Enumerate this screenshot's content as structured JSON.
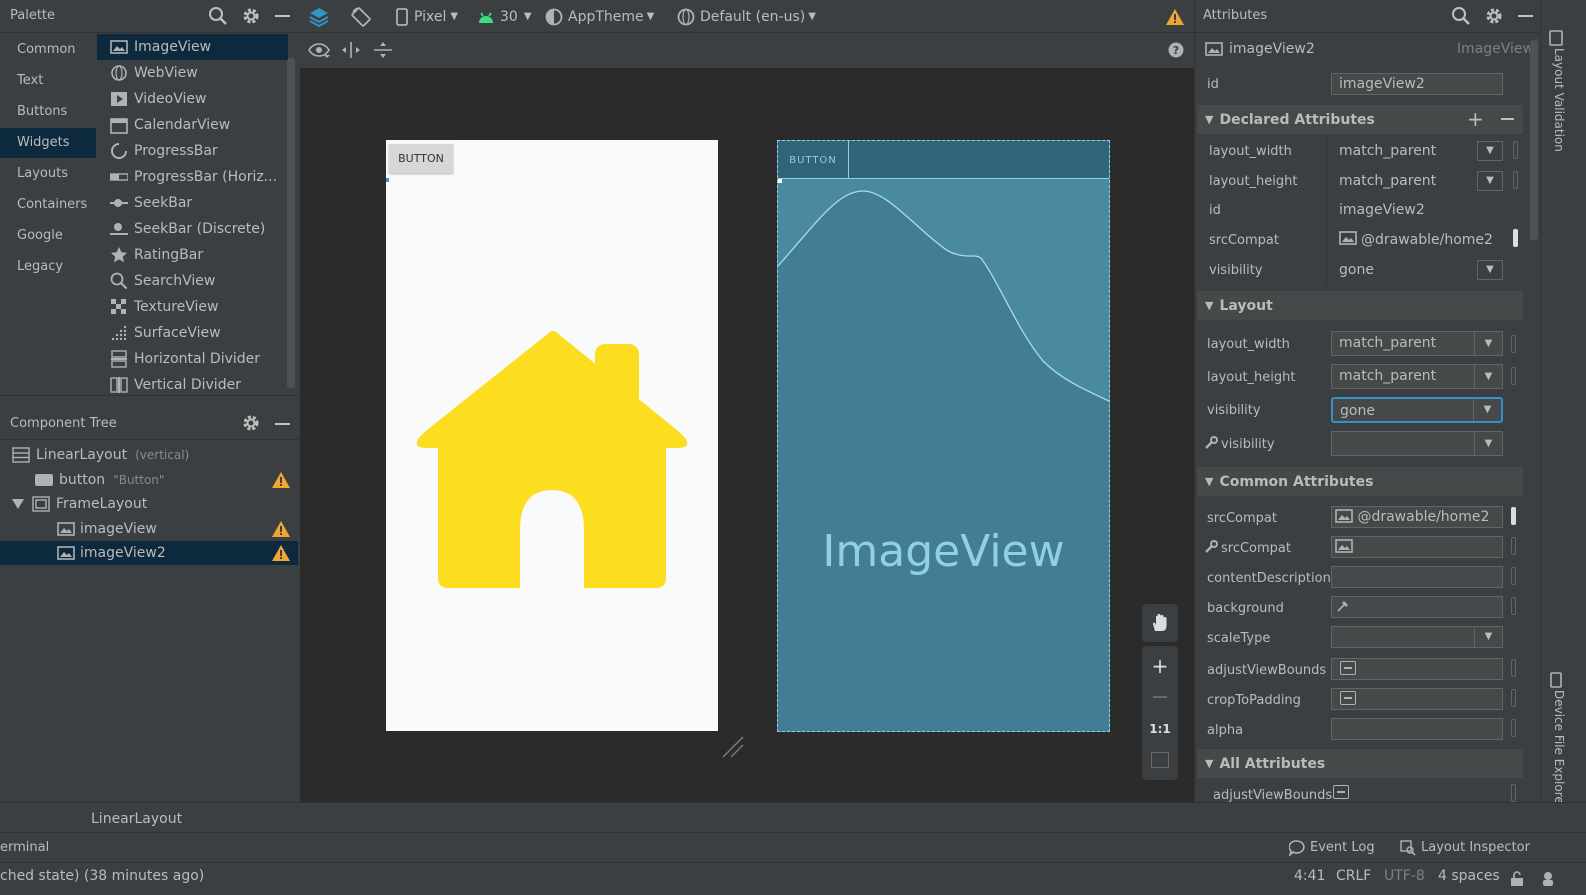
{
  "palette": {
    "title": "Palette",
    "categories": [
      "Common",
      "Text",
      "Buttons",
      "Widgets",
      "Layouts",
      "Containers",
      "Google",
      "Legacy"
    ],
    "selected_category": "Widgets",
    "items": [
      "ImageView",
      "WebView",
      "VideoView",
      "CalendarView",
      "ProgressBar",
      "ProgressBar (Horiz...",
      "SeekBar",
      "SeekBar (Discrete)",
      "RatingBar",
      "SearchView",
      "TextureView",
      "SurfaceView",
      "Horizontal Divider",
      "Vertical Divider"
    ],
    "selected_item": "ImageView"
  },
  "component_tree": {
    "title": "Component Tree",
    "nodes": [
      {
        "label": "LinearLayout",
        "hint": "(vertical)",
        "warning": false
      },
      {
        "label": "button",
        "hint": "\"Button\"",
        "warning": true
      },
      {
        "label": "FrameLayout",
        "hint": "",
        "warning": false
      },
      {
        "label": "imageView",
        "hint": "",
        "warning": true
      },
      {
        "label": "imageView2",
        "hint": "",
        "warning": true
      }
    ],
    "selected": "imageView2"
  },
  "toolbar": {
    "device": "Pixel",
    "api": "30",
    "theme": "AppTheme",
    "locale": "Default (en-us)"
  },
  "design": {
    "button_label": "BUTTON",
    "blueprint_button_label": "BUTTON",
    "blueprint_view_label": "ImageView",
    "house_color": "#fddd1f"
  },
  "zoom": {
    "one_to_one": "1:1"
  },
  "attributes": {
    "title": "Attributes",
    "component_name": "imageView2",
    "component_type": "ImageView",
    "id_label": "id",
    "id_value": "imageView2",
    "declared": {
      "title": "Declared Attributes",
      "rows": [
        {
          "name": "layout_width",
          "value": "match_parent"
        },
        {
          "name": "layout_height",
          "value": "match_parent"
        },
        {
          "name": "id",
          "value": "imageView2"
        },
        {
          "name": "srcCompat",
          "value": "@drawable/home2"
        },
        {
          "name": "visibility",
          "value": "gone"
        }
      ]
    },
    "layout": {
      "title": "Layout",
      "rows": [
        {
          "name": "layout_width",
          "value": "match_parent"
        },
        {
          "name": "layout_height",
          "value": "match_parent"
        },
        {
          "name": "visibility",
          "value": "gone"
        },
        {
          "name": "visibility",
          "value": ""
        }
      ]
    },
    "common": {
      "title": "Common Attributes",
      "rows": [
        {
          "name": "srcCompat",
          "value": "@drawable/home2"
        },
        {
          "name": "srcCompat",
          "value": ""
        },
        {
          "name": "contentDescription",
          "value": ""
        },
        {
          "name": "background",
          "value": ""
        },
        {
          "name": "scaleType",
          "value": ""
        },
        {
          "name": "adjustViewBounds",
          "value": ""
        },
        {
          "name": "cropToPadding",
          "value": ""
        },
        {
          "name": "alpha",
          "value": ""
        }
      ]
    },
    "all": {
      "title": "All Attributes",
      "rows": [
        {
          "name": "adjustViewBounds",
          "value": ""
        }
      ]
    }
  },
  "side_tabs": {
    "top": "Layout Validation",
    "bottom": "Device File Explorer"
  },
  "breadcrumb": "LinearLayout",
  "tool_windows": {
    "left": "erminal",
    "event_log": "Event Log",
    "layout_inspector": "Layout Inspector"
  },
  "status": {
    "message": "ched state) (38 minutes ago)",
    "position": "4:41",
    "line_sep": "CRLF",
    "encoding": "UTF-8",
    "indent": "4 spaces"
  }
}
